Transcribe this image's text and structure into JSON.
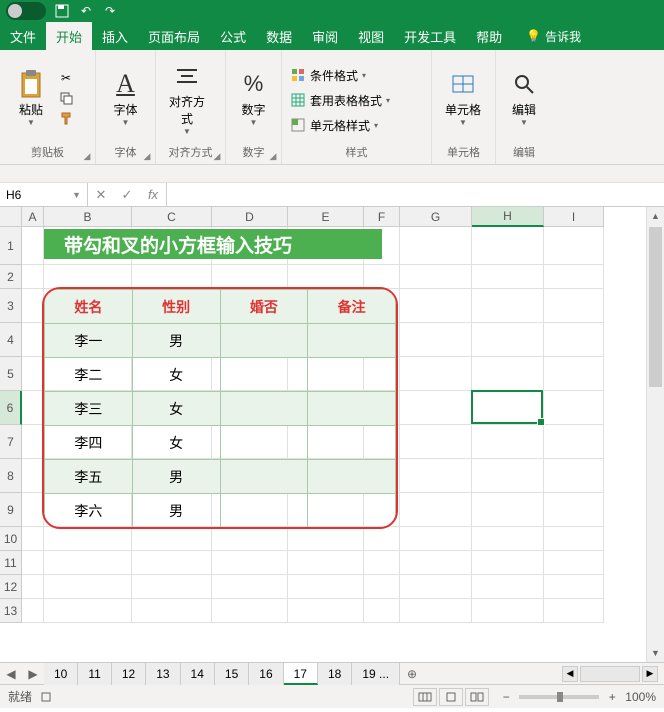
{
  "menus": [
    "文件",
    "开始",
    "插入",
    "页面布局",
    "公式",
    "数据",
    "审阅",
    "视图",
    "开发工具",
    "帮助"
  ],
  "menu_active": 1,
  "tell_me": "告诉我",
  "ribbon": {
    "clipboard": {
      "paste": "粘贴",
      "label": "剪贴板"
    },
    "font": {
      "big": "字体",
      "label": "字体"
    },
    "align": {
      "big": "对齐方式",
      "label": "对齐方式"
    },
    "number": {
      "big": "数字",
      "label": "数字"
    },
    "styles": {
      "cond": "条件格式",
      "tbl": "套用表格格式",
      "cell": "单元格样式",
      "label": "样式"
    },
    "cells": {
      "big": "单元格",
      "label": "单元格"
    },
    "edit": {
      "big": "编辑",
      "label": "编辑"
    }
  },
  "formula_bar": {
    "name": "H6",
    "fx": "fx",
    "value": ""
  },
  "columns": [
    {
      "l": "A",
      "w": 22
    },
    {
      "l": "B",
      "w": 88
    },
    {
      "l": "C",
      "w": 80
    },
    {
      "l": "D",
      "w": 76
    },
    {
      "l": "E",
      "w": 76
    },
    {
      "l": "F",
      "w": 36
    },
    {
      "l": "G",
      "w": 72
    },
    {
      "l": "H",
      "w": 72
    },
    {
      "l": "I",
      "w": 60
    }
  ],
  "col_selected": 7,
  "rows": [
    38,
    24,
    34,
    34,
    34,
    34,
    34,
    34,
    34,
    24,
    24,
    24,
    24
  ],
  "row_selected": 5,
  "active": {
    "col": 7,
    "row": 5
  },
  "banner": "带勾和叉的小方框输入技巧",
  "table": {
    "headers": [
      "姓名",
      "性别",
      "婚否",
      "备注"
    ],
    "rows": [
      [
        "李一",
        "男",
        "",
        ""
      ],
      [
        "李二",
        "女",
        "",
        ""
      ],
      [
        "李三",
        "女",
        "",
        ""
      ],
      [
        "李四",
        "女",
        "",
        ""
      ],
      [
        "李五",
        "男",
        "",
        ""
      ],
      [
        "李六",
        "男",
        "",
        ""
      ]
    ]
  },
  "sheets": [
    "10",
    "11",
    "12",
    "13",
    "14",
    "15",
    "16",
    "17",
    "18",
    "19 ..."
  ],
  "sheet_active": 7,
  "status": {
    "ready": "就绪",
    "zoom": "100%"
  },
  "chart_data": {
    "type": "table",
    "title": "带勾和叉的小方框输入技巧",
    "columns": [
      "姓名",
      "性别",
      "婚否",
      "备注"
    ],
    "rows": [
      {
        "姓名": "李一",
        "性别": "男",
        "婚否": "",
        "备注": ""
      },
      {
        "姓名": "李二",
        "性别": "女",
        "婚否": "",
        "备注": ""
      },
      {
        "姓名": "李三",
        "性别": "女",
        "婚否": "",
        "备注": ""
      },
      {
        "姓名": "李四",
        "性别": "女",
        "婚否": "",
        "备注": ""
      },
      {
        "姓名": "李五",
        "性别": "男",
        "婚否": "",
        "备注": ""
      },
      {
        "姓名": "李六",
        "性别": "男",
        "婚否": "",
        "备注": ""
      }
    ]
  }
}
